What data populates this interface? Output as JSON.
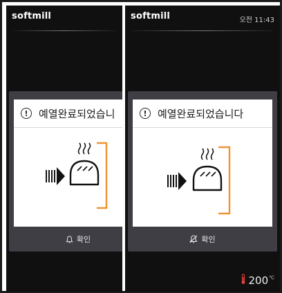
{
  "left_panel": {
    "brand": "softmill",
    "dialog": {
      "title": "예열완료되었습니",
      "confirm_label": "확인"
    },
    "icons": [
      "info-icon",
      "arrow-right-icon",
      "bread-icon",
      "steam-icon",
      "oven-door-icon",
      "bell-icon"
    ]
  },
  "right_panel": {
    "brand": "softmill",
    "clock": "오전 11:43",
    "dialog": {
      "title": "예열완료되었습니다",
      "confirm_label": "확인"
    },
    "temperature": {
      "value": "200",
      "unit": "℃"
    },
    "icons": [
      "info-icon",
      "arrow-right-icon",
      "bread-icon",
      "steam-icon",
      "oven-door-icon",
      "bell-muted-icon",
      "thermometer-icon"
    ]
  },
  "colors": {
    "screen_bg": "#101010",
    "dialog_bg": "#3e3e44",
    "oven_accent": "#f19332",
    "thermo_red": "#e0403a"
  }
}
